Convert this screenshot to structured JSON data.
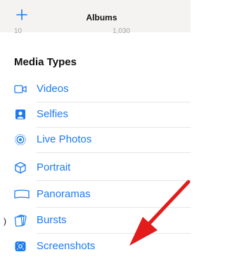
{
  "header": {
    "title": "Albums",
    "add_icon": "plus-icon"
  },
  "partial_counts": [
    "10",
    "1,030"
  ],
  "section": {
    "title": "Media Types"
  },
  "items": [
    {
      "label": "Videos",
      "icon": "video-icon"
    },
    {
      "label": "Selfies",
      "icon": "selfie-icon"
    },
    {
      "label": "Live Photos",
      "icon": "live-photos-icon"
    },
    {
      "label": "Portrait",
      "icon": "portrait-cube-icon"
    },
    {
      "label": "Panoramas",
      "icon": "panorama-icon"
    },
    {
      "label": "Bursts",
      "icon": "bursts-icon"
    },
    {
      "label": "Screenshots",
      "icon": "screenshot-icon"
    }
  ],
  "colors": {
    "accent": "#1b7cf1",
    "annotation_arrow": "#e31b1b"
  }
}
